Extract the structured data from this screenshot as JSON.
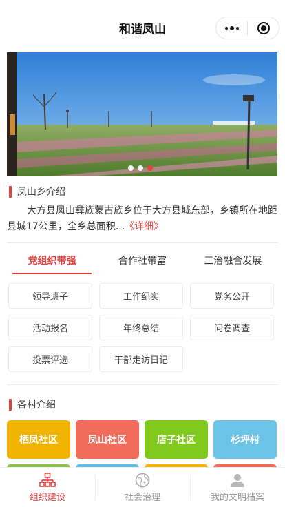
{
  "header": {
    "title": "和谐凤山",
    "more_icon": "more-dots-icon",
    "close_icon": "target-circle-icon"
  },
  "banner": {
    "dot_count": 3,
    "active_index": 2
  },
  "intro": {
    "section_title": "凤山乡介绍",
    "text": "大方县凤山彝族蒙古族乡位于大方县城东部，乡镇所在地距县城17公里，全乡总面积...",
    "more_label": "《详细》"
  },
  "tabs": [
    {
      "label": "党组织带强",
      "active": true
    },
    {
      "label": "合作社带富",
      "active": false
    },
    {
      "label": "三治融合发展",
      "active": false
    }
  ],
  "grid": [
    "领导班子",
    "工作纪实",
    "党务公开",
    "活动报名",
    "年终总结",
    "问卷调查",
    "投票评选",
    "干部走访日记"
  ],
  "villages": {
    "section_title": "各村介绍",
    "items": [
      {
        "name": "栖凤社区",
        "color": "#f0b400"
      },
      {
        "name": "凤山社区",
        "color": "#f26b5b"
      },
      {
        "name": "店子社区",
        "color": "#82c91e"
      },
      {
        "name": "杉坪村",
        "color": "#6cc4e8"
      }
    ],
    "next_row_colors": [
      "#8bc34a",
      "#5bc0de",
      "#f0b400",
      "#f26b5b"
    ]
  },
  "colors": {
    "accent": "#e64340"
  },
  "bottom_nav": [
    {
      "label": "组织建设",
      "icon": "org-chart-icon",
      "active": true
    },
    {
      "label": "社会治理",
      "icon": "globe-icon",
      "active": false
    },
    {
      "label": "我的文明档案",
      "icon": "user-icon",
      "active": false
    }
  ]
}
